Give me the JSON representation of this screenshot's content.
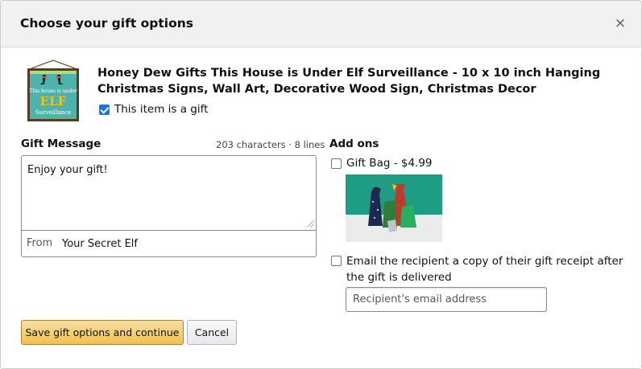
{
  "dialog": {
    "title": "Choose your gift options",
    "close_label": "×"
  },
  "product": {
    "image_icon": "wood-sign-image",
    "image_text": [
      "This house is under",
      "ELF",
      "Surveillance"
    ],
    "title": "Honey Dew Gifts This House is Under Elf Surveillance - 10 x 10 inch Hanging Christmas Signs, Wall Art, Decorative Wood Sign, Christmas Decor",
    "is_gift_label": "This item is a gift",
    "is_gift_checked": true
  },
  "gift_message": {
    "label": "Gift Message",
    "counter": "203 characters · 8 lines",
    "value": "Enjoy your gift!",
    "from_label": "From",
    "from_value": "Your Secret Elf"
  },
  "addons": {
    "label": "Add ons",
    "gift_bag_label": "Gift Bag - $4.99",
    "gift_bag_checked": false,
    "gift_bag_image_icon": "gift-bags-image",
    "email_receipt_label": "Email the recipient a copy of their gift receipt after the gift is delivered",
    "email_receipt_checked": false,
    "email_placeholder": "Recipient's email address"
  },
  "actions": {
    "save_label": "Save gift options and continue",
    "cancel_label": "Cancel"
  },
  "colors": {
    "header_bg": "#f0f2f2",
    "primary_button": "#f0c14b",
    "checkbox_accent": "#1a73e8"
  }
}
